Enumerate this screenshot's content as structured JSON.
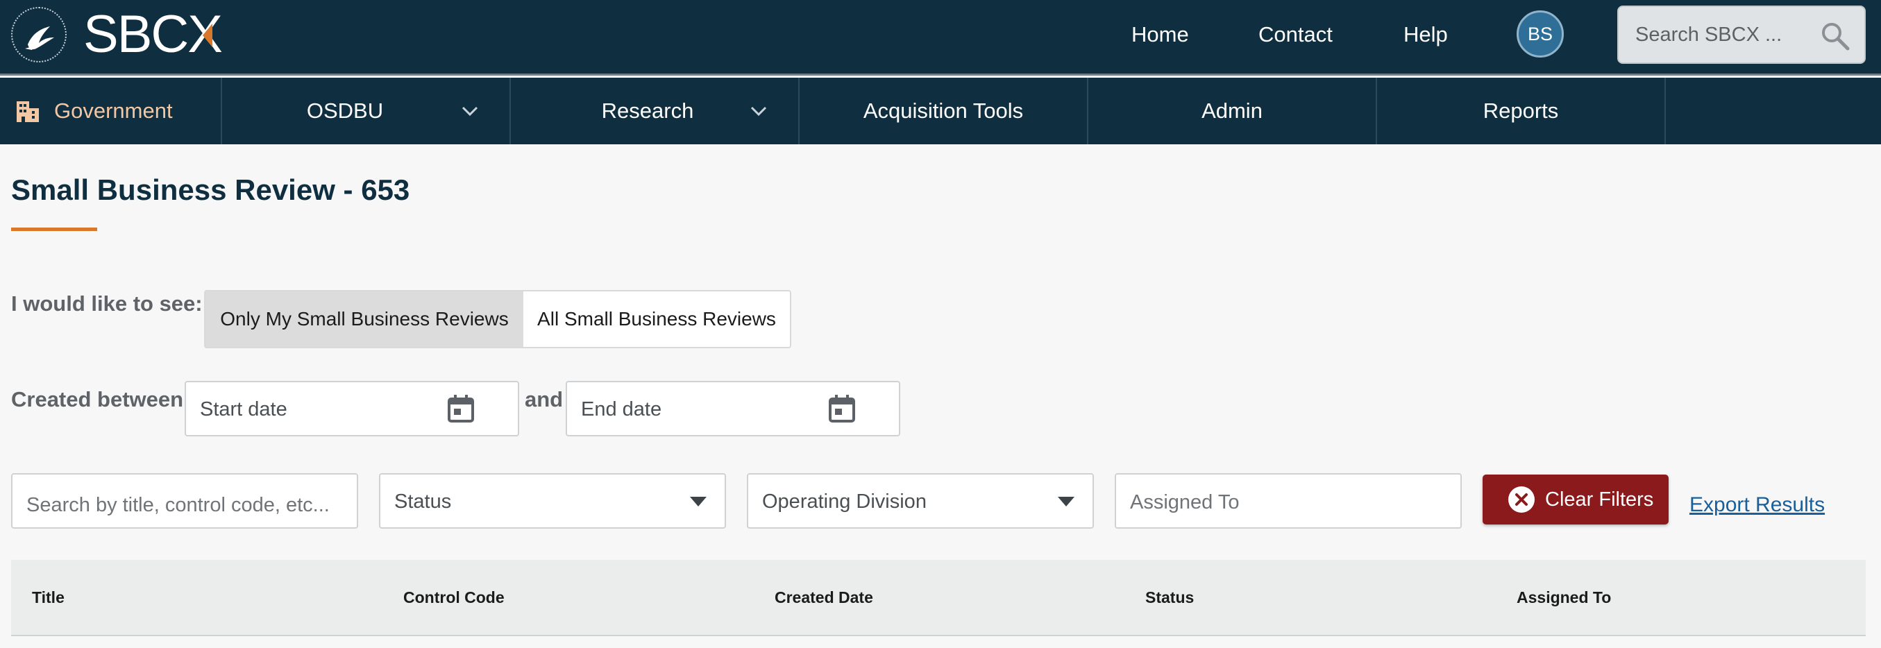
{
  "brand": {
    "name": "SBCX"
  },
  "topnav": {
    "links": [
      "Home",
      "Contact",
      "Help"
    ],
    "avatar_initials": "BS",
    "search_placeholder": "Search SBCX ..."
  },
  "subnav": {
    "government_label": "Government",
    "items": [
      {
        "label": "OSDBU",
        "has_dropdown": true
      },
      {
        "label": "Research",
        "has_dropdown": true
      },
      {
        "label": "Acquisition Tools",
        "has_dropdown": false
      },
      {
        "label": "Admin",
        "has_dropdown": false
      },
      {
        "label": "Reports",
        "has_dropdown": false
      }
    ]
  },
  "page": {
    "title": "Small Business Review - 653"
  },
  "view_toggle": {
    "label": "I would like to see:",
    "options": [
      "Only My Small Business Reviews",
      "All Small Business Reviews"
    ],
    "selected": "Only My Small Business Reviews"
  },
  "date_filter": {
    "label": "Created between:",
    "start_placeholder": "Start date",
    "joiner": "and",
    "end_placeholder": "End date"
  },
  "filters": {
    "search_placeholder": "Search by title, control code, etc...",
    "status_label": "Status",
    "division_label": "Operating Division",
    "assigned_placeholder": "Assigned To",
    "clear_label": "Clear Filters",
    "export_label": "Export Results"
  },
  "table": {
    "columns": [
      "Title",
      "Control Code",
      "Created Date",
      "Status",
      "Assigned To"
    ]
  },
  "colors": {
    "nav_bg": "#0f2e40",
    "accent_orange": "#d9772b",
    "clear_button": "#8a1a1c",
    "link": "#1a5f99"
  }
}
